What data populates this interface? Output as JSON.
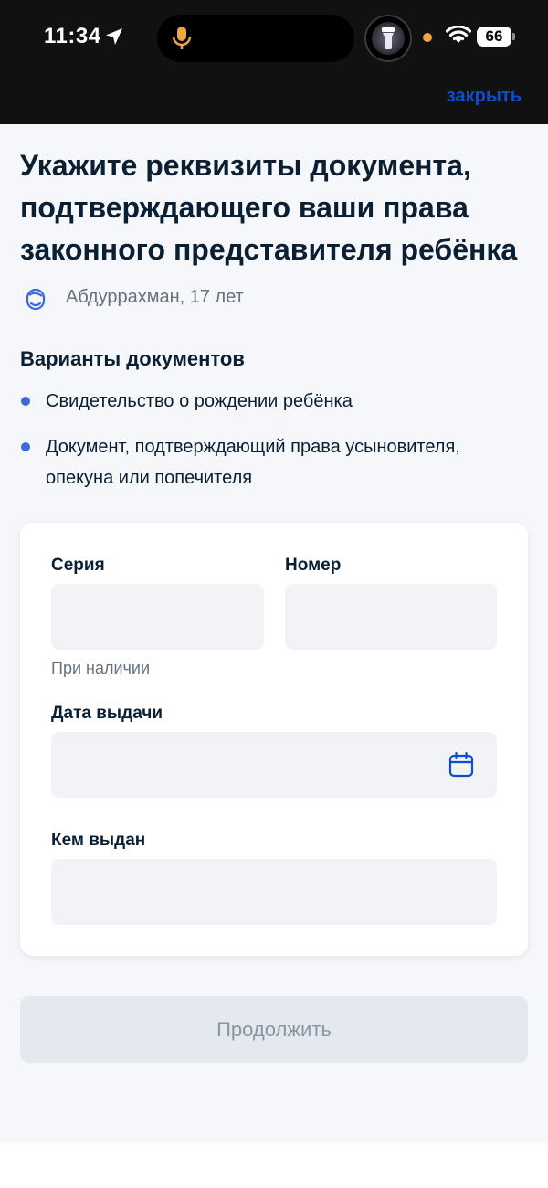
{
  "status_bar": {
    "time": "11:34",
    "battery": "66"
  },
  "header": {
    "close_label": "закрыть"
  },
  "page": {
    "title": "Укажите реквизиты документа, подтверждающего ваши права законного представителя ребёнка",
    "child_name": "Абдуррахман, 17 лет"
  },
  "documents": {
    "title": "Варианты документов",
    "items": [
      "Свидетельство о рождении ребёнка",
      "Документ, подтверждающий права усыновителя, опекуна или попечителя"
    ]
  },
  "form": {
    "series_label": "Серия",
    "series_value": "",
    "series_hint": "При наличии",
    "number_label": "Номер",
    "number_value": "",
    "issue_date_label": "Дата выдачи",
    "issue_date_value": "",
    "issued_by_label": "Кем выдан",
    "issued_by_value": ""
  },
  "actions": {
    "continue_label": "Продолжить"
  },
  "colors": {
    "accent": "#0d4cd3",
    "bullet": "#3b6ad6",
    "input_bg": "#f2f3f7",
    "page_bg": "#f6f7fb",
    "disabled_button_bg": "#e4e8ef"
  },
  "icons": {
    "location": "location-arrow-icon",
    "mic": "microphone-icon",
    "torch": "flashlight-icon",
    "wifi": "wifi-icon",
    "child": "child-face-icon",
    "calendar": "calendar-icon"
  }
}
